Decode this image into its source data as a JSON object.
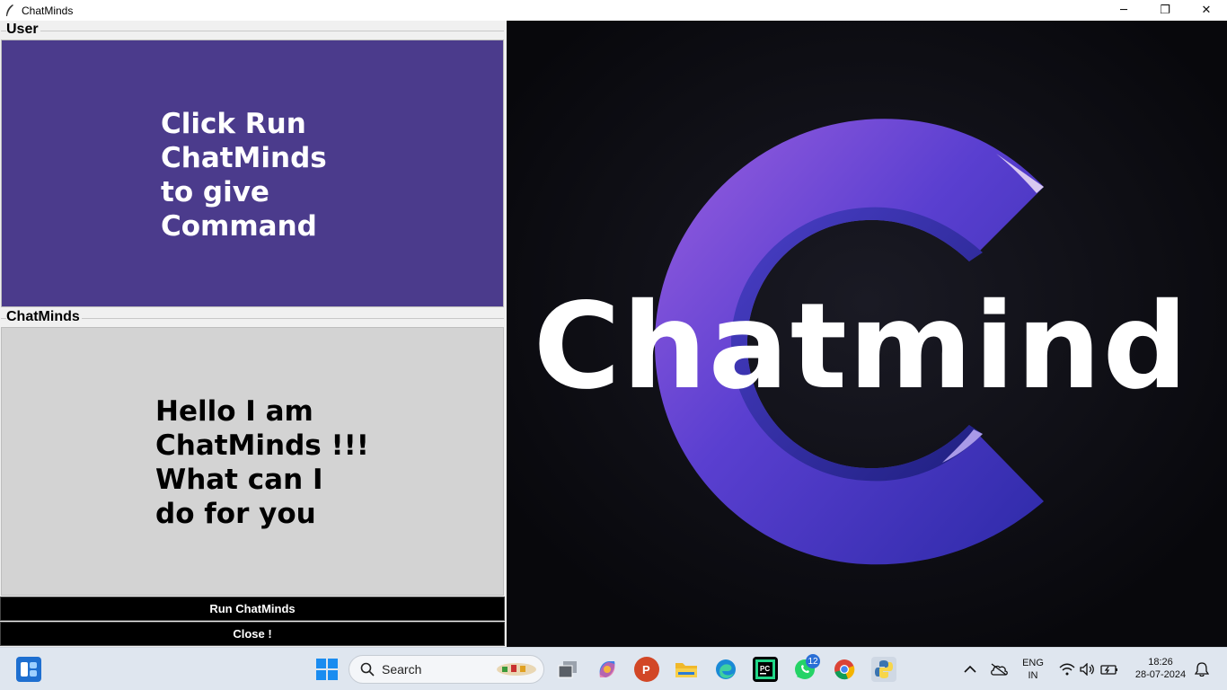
{
  "window": {
    "title": "ChatMinds",
    "minimize_glyph": "─",
    "restore_glyph": "❐",
    "close_glyph": "✕"
  },
  "user_panel": {
    "label": "User",
    "message": "Click Run ChatMinds to give Command",
    "bg_color": "#4b3b8c"
  },
  "bot_panel": {
    "label": "ChatMinds",
    "message": "Hello I am ChatMinds !!! What can I do for you",
    "bg_color": "#d3d3d3"
  },
  "buttons": {
    "run_label": "Run ChatMinds",
    "close_label": "Close !"
  },
  "brand_image": {
    "wordmark": "Chatmind",
    "accent_color": "#6a3fd6"
  },
  "taskbar": {
    "search_placeholder": "Search",
    "whatsapp_badge": "12",
    "lang_top": "ENG",
    "lang_bottom": "IN",
    "time": "18:26",
    "date": "28-07-2024",
    "icons": [
      "widgets-icon",
      "windows-start-icon",
      "search-icon",
      "task-view-icon",
      "copilot-icon",
      "powerpoint-icon",
      "file-explorer-icon",
      "edge-icon",
      "pycharm-icon",
      "whatsapp-icon",
      "chrome-icon",
      "python-icon",
      "chevron-up-icon",
      "onedrive-icon",
      "wifi-icon",
      "volume-icon",
      "battery-icon",
      "notification-icon"
    ]
  }
}
